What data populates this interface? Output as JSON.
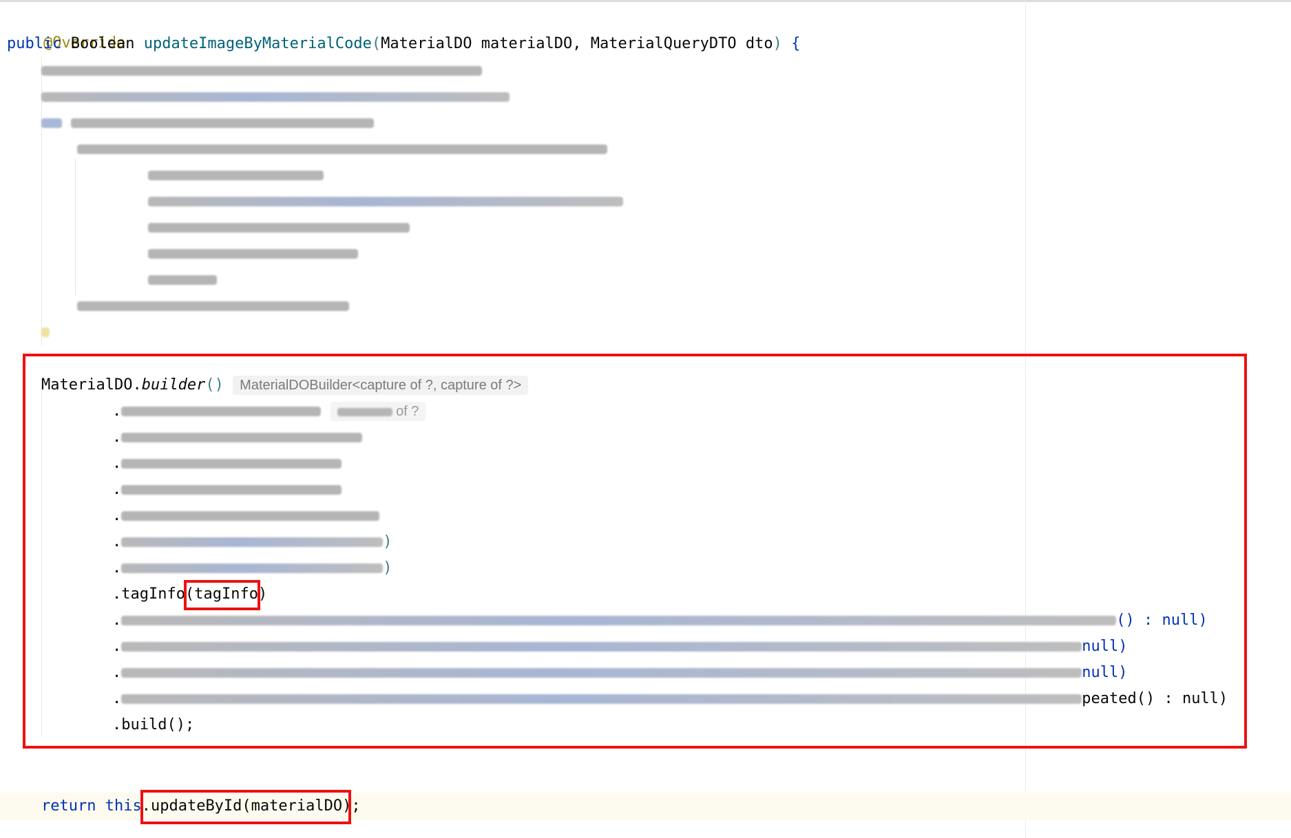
{
  "code": {
    "annotation": "@Override",
    "signature": {
      "kw_public": "public",
      "return_type": "Boolean",
      "method_name": "updateImageByMaterialCode",
      "open_paren": "(",
      "params": "MaterialDO materialDO, MaterialQueryDTO dto",
      "close_paren": ")",
      "open_brace": "{"
    },
    "builder_line": {
      "receiver": "MaterialDO.",
      "method": "builder",
      "parens": "()",
      "type_hint": "MaterialDOBuilder<capture of ?, capture of ?>"
    },
    "id_line_hint": "of ?",
    "tag_info_line": {
      "method": ".tagInfo(",
      "arg": "tagInfo",
      "close": ")"
    },
    "safety_stock_tail": "() : null)",
    "max_stock_tail": "null)",
    "lead_time_tail": "null)",
    "enable_repeated_tail": "peated() : null)",
    "build_line": ".build();",
    "return_line": {
      "kw_return": "return",
      "kw_this": "this",
      "dot": ".",
      "call": "updateById(materialDO);"
    }
  },
  "colors": {
    "highlight_box": "#ee1111",
    "keyword": "#0033b3",
    "annotation": "#9e880d",
    "method_declaration": "#00627a"
  }
}
